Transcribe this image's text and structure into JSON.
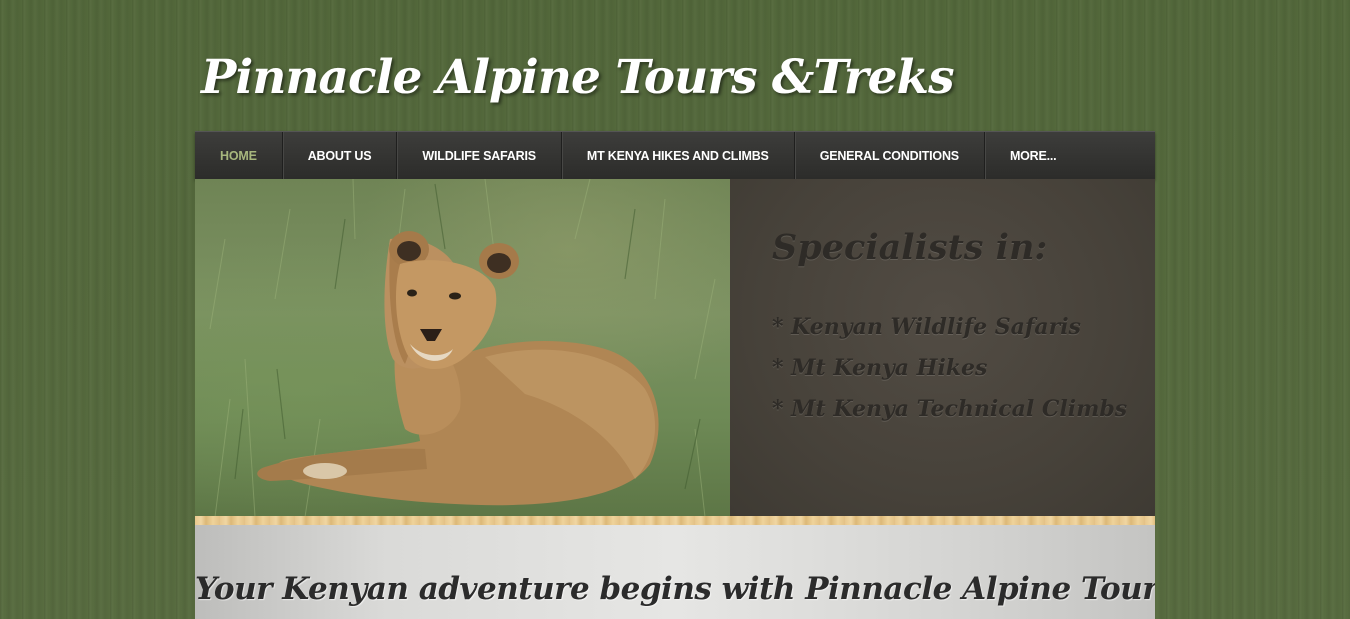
{
  "site": {
    "title": "Pinnacle Alpine Tours &Treks"
  },
  "nav": {
    "items": [
      {
        "label": "HOME"
      },
      {
        "label": "ABOUT US"
      },
      {
        "label": "WILDLIFE SAFARIS"
      },
      {
        "label": "MT KENYA HIKES AND CLIMBS"
      },
      {
        "label": "GENERAL CONDITIONS"
      },
      {
        "label": "MORE..."
      }
    ],
    "active_color": "#a7b77d"
  },
  "hero": {
    "image": "lioness-photo",
    "heading": "Specialists in:",
    "list": [
      "* Kenyan Wildlife Safaris",
      "* Mt Kenya Hikes",
      "* Mt Kenya Technical Climbs"
    ]
  },
  "content": {
    "heading": "Your Kenyan adventure begins with Pinnacle Alpine Tours & Treks!"
  },
  "colors": {
    "background": "#566a3e",
    "nav_bg": "#333331",
    "hero_panel": "#4a453d"
  }
}
